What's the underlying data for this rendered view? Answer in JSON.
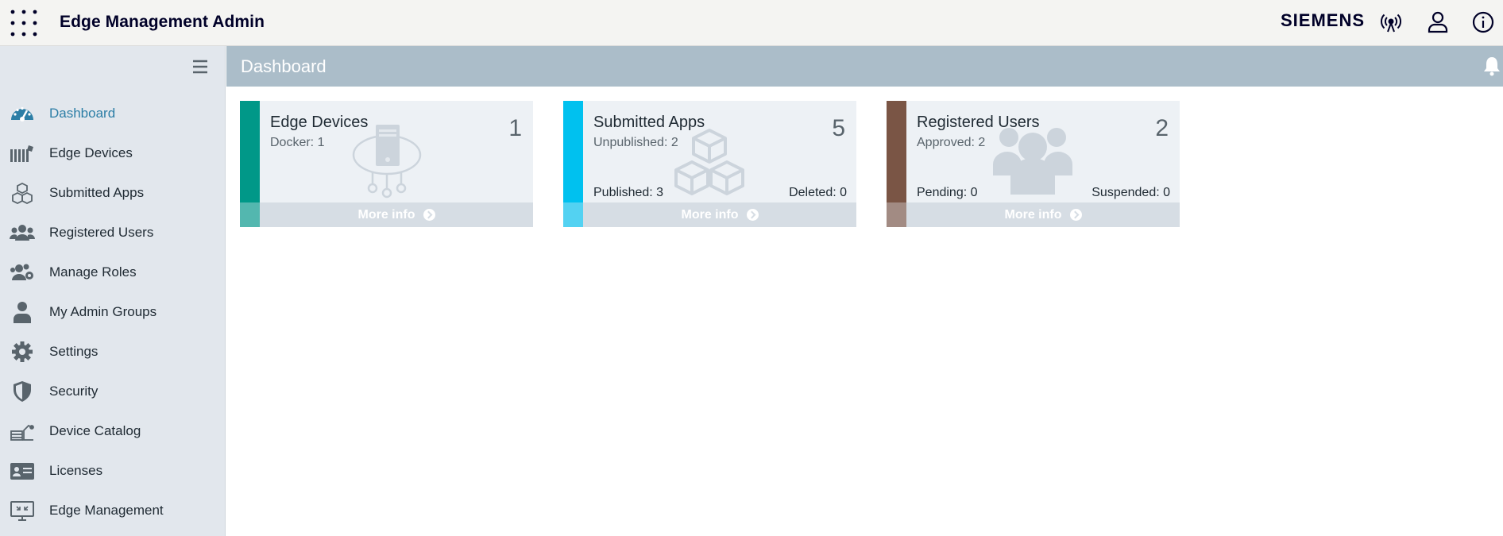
{
  "header": {
    "title": "Edge Management Admin",
    "brand": "SIEMENS",
    "icons": [
      "app-launcher-icon",
      "connectivity-icon",
      "user-icon",
      "info-icon"
    ]
  },
  "sidebar": {
    "items": [
      {
        "label": "Dashboard",
        "icon": "dashboard-icon",
        "active": true
      },
      {
        "label": "Edge Devices",
        "icon": "edge-devices-icon"
      },
      {
        "label": "Submitted Apps",
        "icon": "cubes-icon"
      },
      {
        "label": "Registered Users",
        "icon": "users-icon"
      },
      {
        "label": "Manage Roles",
        "icon": "roles-icon"
      },
      {
        "label": "My Admin Groups",
        "icon": "person-icon"
      },
      {
        "label": "Settings",
        "icon": "gear-icon"
      },
      {
        "label": "Security",
        "icon": "shield-icon"
      },
      {
        "label": "Device Catalog",
        "icon": "device-catalog-icon"
      },
      {
        "label": "Licenses",
        "icon": "license-card-icon"
      },
      {
        "label": "Edge Management",
        "icon": "monitor-icon"
      }
    ]
  },
  "page": {
    "title": "Dashboard"
  },
  "cards": [
    {
      "title": "Edge Devices",
      "sub": "Docker: 1",
      "count": "1",
      "bottom_left": "",
      "bottom_right": "",
      "more": "More info",
      "color": "#009888"
    },
    {
      "title": "Submitted Apps",
      "sub": "Unpublished: 2",
      "count": "5",
      "bottom_left": "Published: 3",
      "bottom_right": "Deleted: 0",
      "more": "More info",
      "color": "#00c1ef"
    },
    {
      "title": "Registered Users",
      "sub": "Approved: 2",
      "count": "2",
      "bottom_left": "Pending: 0",
      "bottom_right": "Suspended: 0",
      "more": "More info",
      "color": "#7a5545"
    }
  ],
  "colors": {
    "active_nav": "#2c7ea6",
    "page_header": "#abbdc9",
    "sidebar_bg": "#e2e7ed"
  }
}
